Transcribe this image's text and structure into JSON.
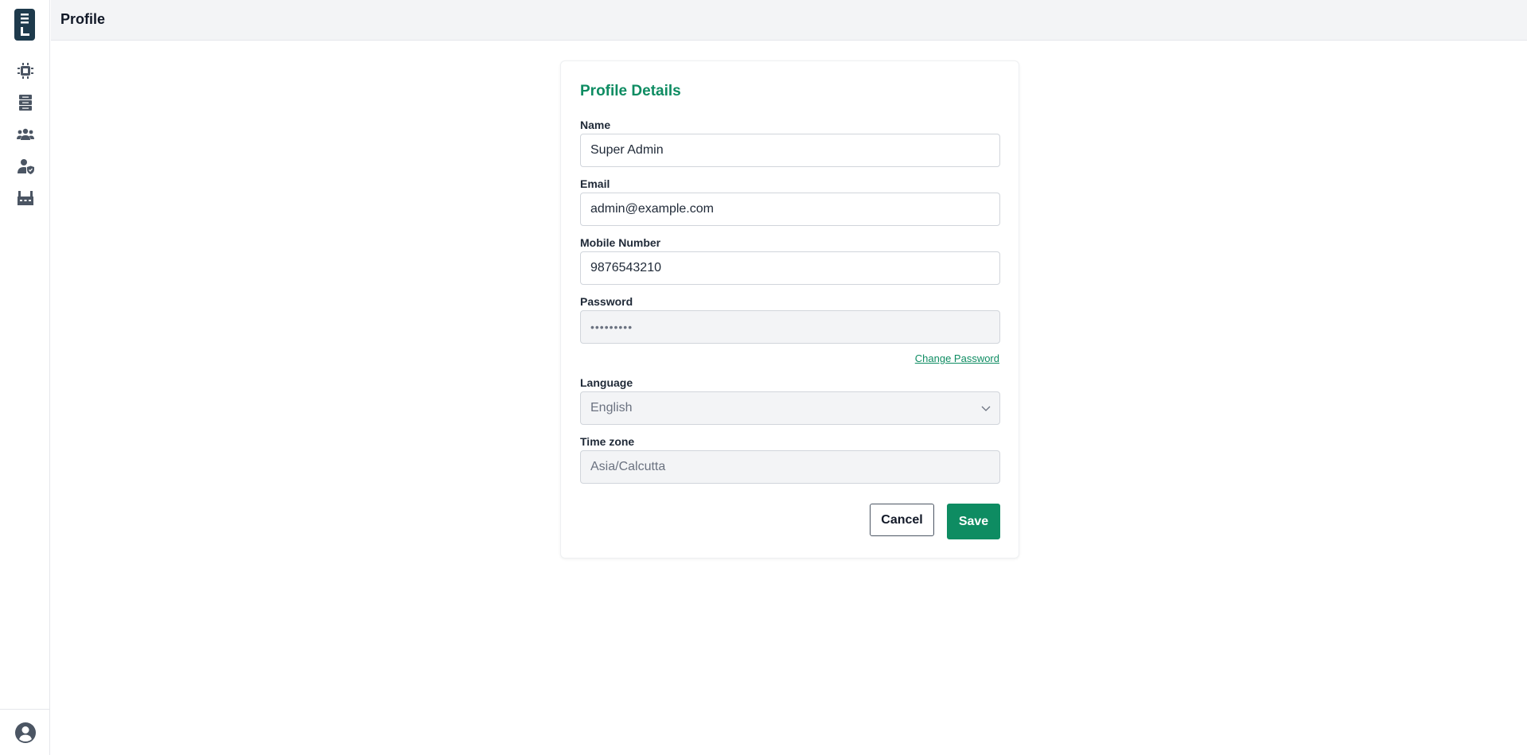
{
  "header": {
    "title": "Profile"
  },
  "sidebar": {
    "items": [
      {
        "name": "chip-icon"
      },
      {
        "name": "server-icon"
      },
      {
        "name": "users-icon"
      },
      {
        "name": "user-shield-icon"
      },
      {
        "name": "factory-icon"
      }
    ],
    "footer_icon": "user-circle-icon"
  },
  "profile": {
    "title": "Profile Details",
    "name_label": "Name",
    "name_value": "Super Admin",
    "email_label": "Email",
    "email_value": "admin@example.com",
    "mobile_label": "Mobile Number",
    "mobile_value": "9876543210",
    "password_label": "Password",
    "password_value": "•••••••••",
    "change_password_label": "Change Password",
    "language_label": "Language",
    "language_value": "English",
    "timezone_label": "Time zone",
    "timezone_value": "Asia/Calcutta",
    "cancel_label": "Cancel",
    "save_label": "Save"
  },
  "colors": {
    "accent": "#0e8c62",
    "logo_bg": "#1e3a4c",
    "icon": "#4b5563"
  }
}
